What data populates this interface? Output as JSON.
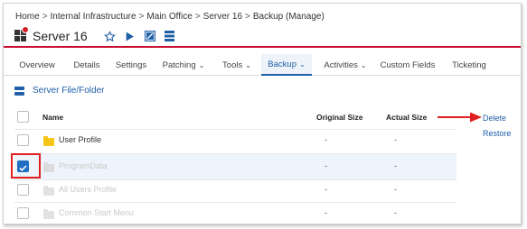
{
  "breadcrumb": [
    "Home",
    "Internal Infrastructure",
    "Main Office",
    "Server 16",
    "Backup (Manage)"
  ],
  "header": {
    "title": "Server 16",
    "icons": [
      "windows-icon",
      "alert-badge-icon",
      "star-icon",
      "play-icon",
      "remote-desktop-icon",
      "server-stack-icon"
    ]
  },
  "tabs": [
    {
      "label": "Overview",
      "dropdown": false
    },
    {
      "label": "Details",
      "dropdown": false
    },
    {
      "label": "Settings",
      "dropdown": false
    },
    {
      "label": "Patching",
      "dropdown": true
    },
    {
      "label": "Tools",
      "dropdown": true
    },
    {
      "label": "Backup",
      "dropdown": true,
      "active": true
    },
    {
      "label": "Activities",
      "dropdown": true
    },
    {
      "label": "Custom Fields",
      "dropdown": false
    },
    {
      "label": "Ticketing",
      "dropdown": false
    }
  ],
  "file_section": {
    "label": "Server File/Folder"
  },
  "table": {
    "columns": [
      "Name",
      "Original Size",
      "Actual Size"
    ],
    "rows": [
      {
        "name": "User Profile",
        "original": "-",
        "actual": "-",
        "checked": false,
        "dimmed": false
      },
      {
        "name": "ProgramData",
        "original": "-",
        "actual": "-",
        "checked": true,
        "dimmed": true
      },
      {
        "name": "All Users Profile",
        "original": "-",
        "actual": "-",
        "checked": false,
        "dimmed": true
      },
      {
        "name": "Common Start Menu",
        "original": "-",
        "actual": "-",
        "checked": false,
        "dimmed": true
      }
    ]
  },
  "actions": {
    "delete": "Delete",
    "restore": "Restore"
  },
  "colors": {
    "accent": "#1f5fa8",
    "brand_red": "#c8102e",
    "annotation_red": "#e02020",
    "folder_yellow": "#f5c518"
  }
}
